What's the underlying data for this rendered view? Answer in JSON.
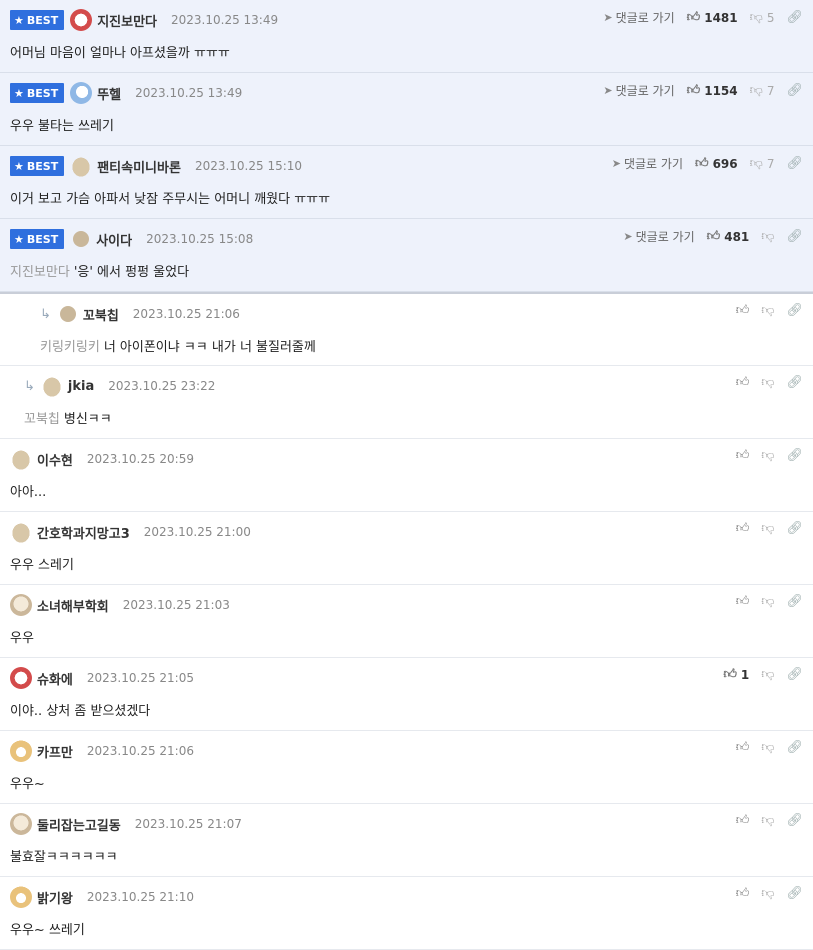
{
  "labels": {
    "best": "BEST",
    "goto": "댓글로 가기"
  },
  "comments": [
    {
      "nick": "지진보만다",
      "date": "2023.10.25 13:49",
      "text": "어머님 마음이 얼마나 아프셨을까 ㅠㅠㅠ",
      "likes": "1481",
      "dislikes": "5"
    },
    {
      "nick": "뚜헬",
      "date": "2023.10.25 13:49",
      "text": "우우 불타는 쓰레기",
      "likes": "1154",
      "dislikes": "7"
    },
    {
      "nick": "팬티속미니바론",
      "date": "2023.10.25 15:10",
      "text": "이거 보고 가슴 아파서 낮잠 주무시는 어머니 깨웠다 ㅠㅠㅠ",
      "likes": "696",
      "dislikes": "7"
    },
    {
      "nick": "사이다",
      "date": "2023.10.25 15:08",
      "mention": "지진보만다",
      "text": "'응' 에서 펑펑 울었다",
      "likes": "481",
      "dislikes": ""
    },
    {
      "nick": "꼬북칩",
      "date": "2023.10.25 21:06",
      "mention": "키링키링키",
      "text": "너 아이폰이냐 ㅋㅋ 내가 너 불질러줄께",
      "likes": "",
      "dislikes": ""
    },
    {
      "nick": "jkia",
      "date": "2023.10.25 23:22",
      "mention": "꼬북칩",
      "text": "병신ㅋㅋ",
      "likes": "",
      "dislikes": ""
    },
    {
      "nick": "이수현",
      "date": "2023.10.25 20:59",
      "text": "아아...",
      "likes": "",
      "dislikes": ""
    },
    {
      "nick": "간호학과지망고3",
      "date": "2023.10.25 21:00",
      "text": "우우 스레기",
      "likes": "",
      "dislikes": ""
    },
    {
      "nick": "소녀해부학회",
      "date": "2023.10.25 21:03",
      "text": "우우",
      "likes": "",
      "dislikes": ""
    },
    {
      "nick": "슈화에",
      "date": "2023.10.25 21:05",
      "text": "이야.. 상처 좀 받으셨겠다",
      "likes": "1",
      "dislikes": ""
    },
    {
      "nick": "카프만",
      "date": "2023.10.25 21:06",
      "text": "우우~",
      "likes": "",
      "dislikes": ""
    },
    {
      "nick": "둘리잡는고길동",
      "date": "2023.10.25 21:07",
      "text": "불효잘ㅋㅋㅋㅋㅋㅋ",
      "likes": "",
      "dislikes": ""
    },
    {
      "nick": "밝기왕",
      "date": "2023.10.25 21:10",
      "text": "우우~ 쓰레기",
      "likes": "",
      "dislikes": ""
    }
  ],
  "icons": {
    "star": "star-icon",
    "avatar": "avatar",
    "goto": "send-arrow-icon",
    "like": "thumbs-up-icon",
    "dislike": "thumbs-down-icon",
    "link": "link-icon",
    "reply": "reply-arrow-icon"
  },
  "colors": {
    "best_badge": "#2f6fde",
    "best_bg": "#eef2fb",
    "mention": "#999999"
  }
}
